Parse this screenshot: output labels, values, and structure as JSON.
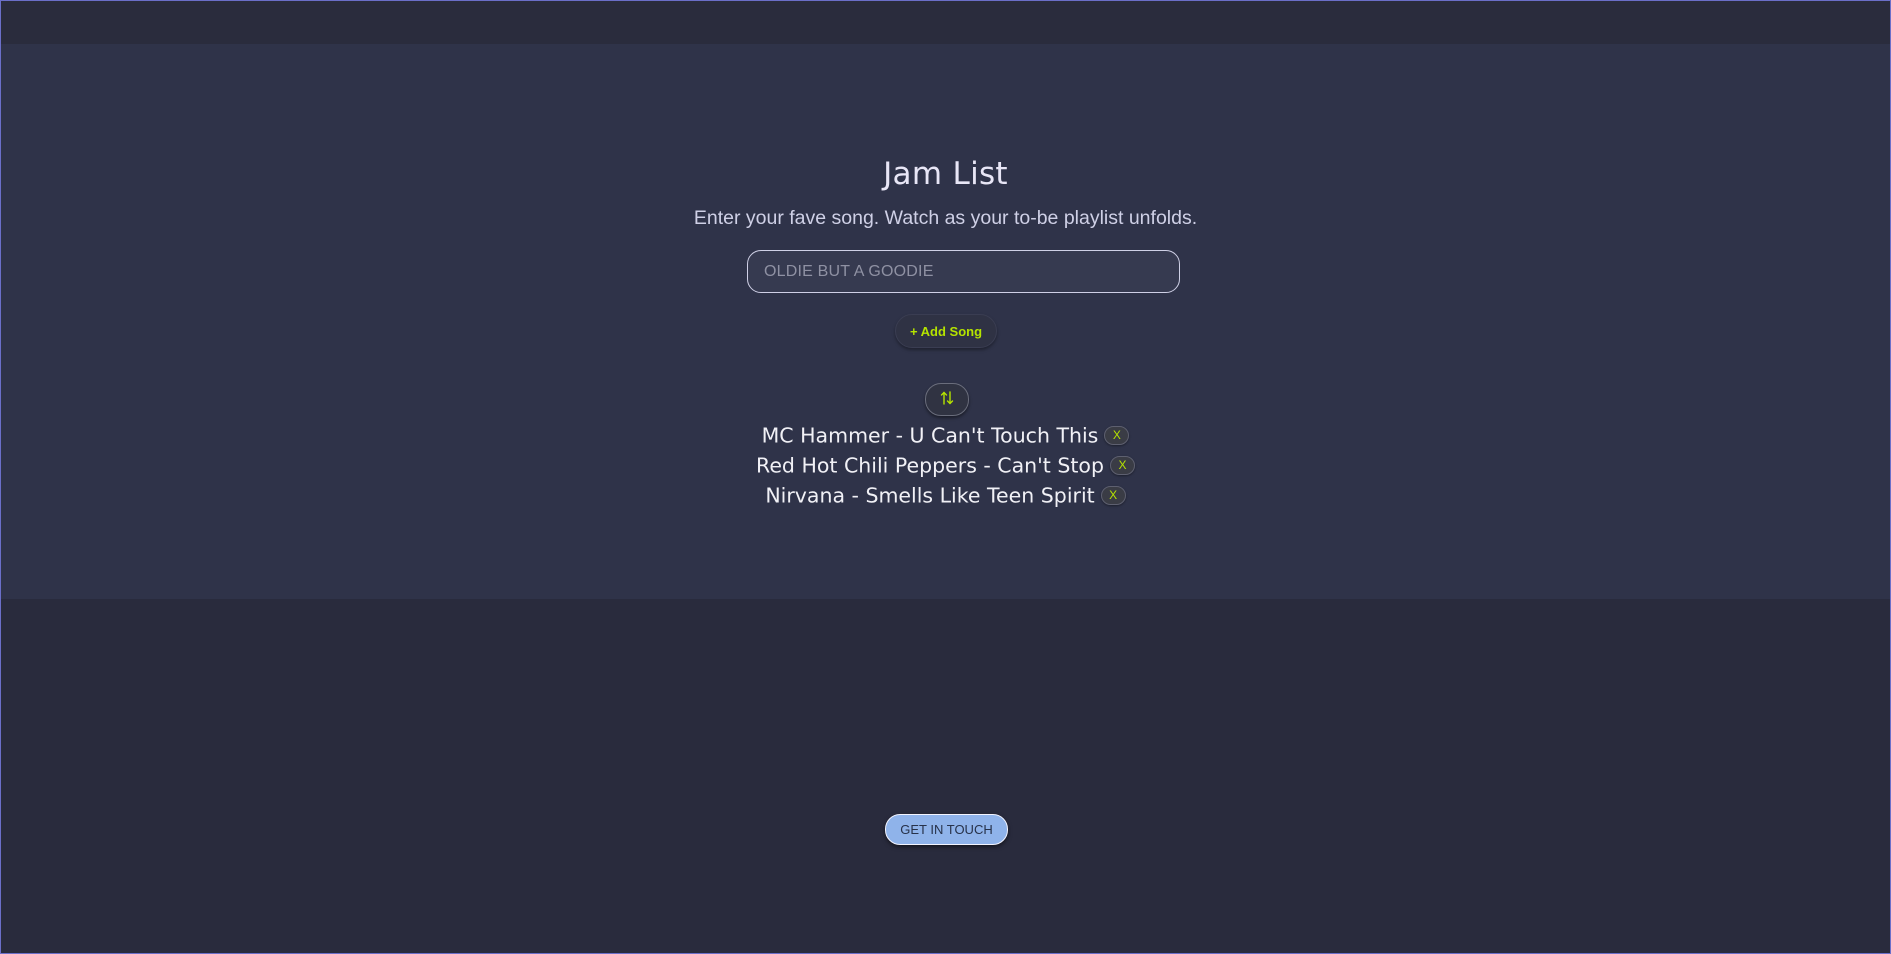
{
  "header": {
    "title": "Jam List",
    "subtitle": "Enter your fave song. Watch as your to-be playlist unfolds."
  },
  "form": {
    "song_input_placeholder": "OLDIE BUT A GOODIE",
    "song_input_value": "",
    "add_button_label": "+ Add Song"
  },
  "sort": {
    "icon": "sort-arrows-icon"
  },
  "songs": [
    {
      "title": "MC Hammer - U Can't Touch This",
      "remove_label": "X"
    },
    {
      "title": "Red Hot Chili Peppers - Can't Stop",
      "remove_label": "X"
    },
    {
      "title": "Nirvana - Smells Like Teen Spirit",
      "remove_label": "X"
    }
  ],
  "footer": {
    "contact_button_label": "GET IN TOUCH"
  },
  "colors": {
    "page_background": "#292b3d",
    "panel_background": "#2f3349",
    "accent": "#b5e300",
    "contact_button": "#8fb3ea"
  }
}
